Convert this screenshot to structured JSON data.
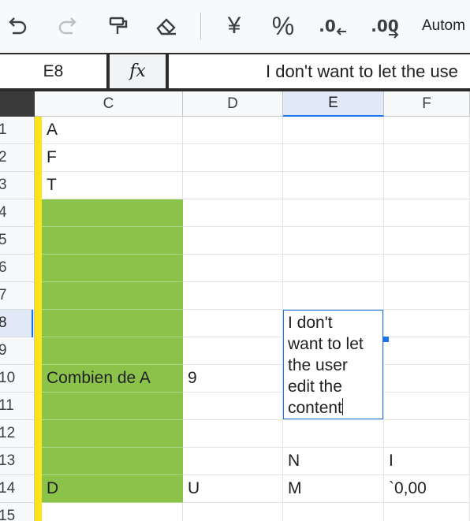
{
  "toolbar": {
    "undo_icon": "undo-icon",
    "redo_icon": "redo-icon",
    "paint_format_icon": "paint-format-icon",
    "clear_format_icon": "eraser-icon",
    "currency_symbol": "¥",
    "percent_symbol": "%",
    "decrease_decimal_label": ".0",
    "increase_decimal_label": ".00",
    "format_label": "Autom"
  },
  "formula_bar": {
    "name_box": "E8",
    "fx_label": "fx",
    "content": "I don't want to let the use"
  },
  "columns": [
    "C",
    "D",
    "E",
    "F"
  ],
  "selected_column": "E",
  "rows": [
    {
      "num": "1",
      "C": "A",
      "D": "",
      "E": "",
      "F": ""
    },
    {
      "num": "2",
      "C": "F",
      "D": "",
      "E": "",
      "F": ""
    },
    {
      "num": "3",
      "C": "T",
      "D": "",
      "E": "",
      "F": ""
    },
    {
      "num": "4",
      "C": "",
      "D": "",
      "E": "",
      "F": ""
    },
    {
      "num": "5",
      "C": "",
      "D": "",
      "E": "",
      "F": ""
    },
    {
      "num": "6",
      "C": "",
      "D": "",
      "E": "",
      "F": ""
    },
    {
      "num": "7",
      "C": "",
      "D": "",
      "E": "",
      "F": ""
    },
    {
      "num": "8",
      "C": "",
      "D": "",
      "E": "",
      "F": ""
    },
    {
      "num": "9",
      "C": "",
      "D": "",
      "E": "",
      "F": ""
    },
    {
      "num": "10",
      "C": "Combien de A",
      "D": "9",
      "E": "",
      "F": ""
    },
    {
      "num": "11",
      "C": "",
      "D": "",
      "E": "",
      "F": ""
    },
    {
      "num": "12",
      "C": "",
      "D": "",
      "E": "",
      "F": ""
    },
    {
      "num": "13",
      "C": "",
      "D": "",
      "E": "N",
      "F": "I"
    },
    {
      "num": "14",
      "C": "D",
      "D": "U",
      "E": "M",
      "F": "`0,00"
    },
    {
      "num": "15",
      "C": "",
      "D": "",
      "E": "",
      "F": ""
    }
  ],
  "editor": {
    "text": "I don't\nwant to let\nthe user\nedit the\ncontent"
  },
  "colors": {
    "green_fill": "#8bc34a",
    "yellow_band": "#fbe51a",
    "selection_blue": "#1a73e8"
  }
}
